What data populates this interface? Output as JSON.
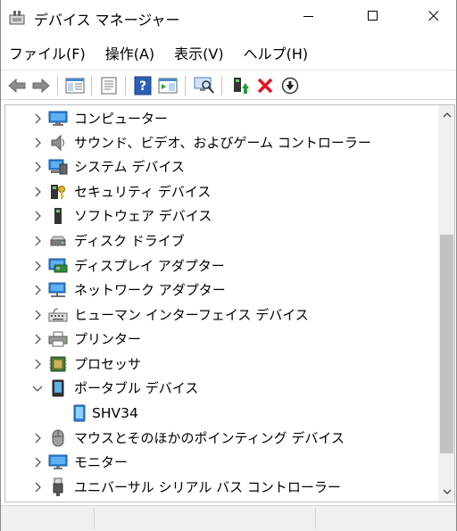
{
  "window": {
    "title": "デバイス マネージャー"
  },
  "menubar": {
    "items": [
      {
        "label": "ファイル(F)"
      },
      {
        "label": "操作(A)"
      },
      {
        "label": "表示(V)"
      },
      {
        "label": "ヘルプ(H)"
      }
    ]
  },
  "toolbar": {
    "buttons": [
      "back-arrow-icon",
      "forward-arrow-icon",
      "show-hide-console-tree-icon",
      "properties-icon",
      "help-icon",
      "action-pane-icon",
      "scan-hardware-icon",
      "update-driver-icon",
      "uninstall-device-icon",
      "disable-device-icon"
    ]
  },
  "tree": {
    "items": [
      {
        "label": "コンピューター",
        "icon": "computer-icon",
        "expanded": false
      },
      {
        "label": "サウンド、ビデオ、およびゲーム コントローラー",
        "icon": "speaker-icon",
        "expanded": false
      },
      {
        "label": "システム デバイス",
        "icon": "system-devices-icon",
        "expanded": false
      },
      {
        "label": "セキュリティ デバイス",
        "icon": "security-key-icon",
        "expanded": false
      },
      {
        "label": "ソフトウェア デバイス",
        "icon": "software-device-icon",
        "expanded": false
      },
      {
        "label": "ディスク ドライブ",
        "icon": "disk-drive-icon",
        "expanded": false
      },
      {
        "label": "ディスプレイ アダプター",
        "icon": "display-adapter-icon",
        "expanded": false
      },
      {
        "label": "ネットワーク アダプター",
        "icon": "network-adapter-icon",
        "expanded": false
      },
      {
        "label": "ヒューマン インターフェイス デバイス",
        "icon": "hid-icon",
        "expanded": false
      },
      {
        "label": "プリンター",
        "icon": "printer-icon",
        "expanded": false
      },
      {
        "label": "プロセッサ",
        "icon": "processor-icon",
        "expanded": false
      },
      {
        "label": "ポータブル デバイス",
        "icon": "portable-device-icon",
        "expanded": true
      },
      {
        "label": "SHV34",
        "icon": "phone-icon",
        "child": true
      },
      {
        "label": "マウスとそのほかのポインティング デバイス",
        "icon": "mouse-icon",
        "expanded": false
      },
      {
        "label": "モニター",
        "icon": "monitor-icon",
        "expanded": false
      },
      {
        "label": "ユニバーサル シリアル バス コントローラー",
        "icon": "usb-icon",
        "expanded": false
      }
    ]
  },
  "colors": {
    "accent_blue": "#1e6fc4",
    "uninstall_red": "#e81123",
    "update_green": "#2a9d3c"
  }
}
